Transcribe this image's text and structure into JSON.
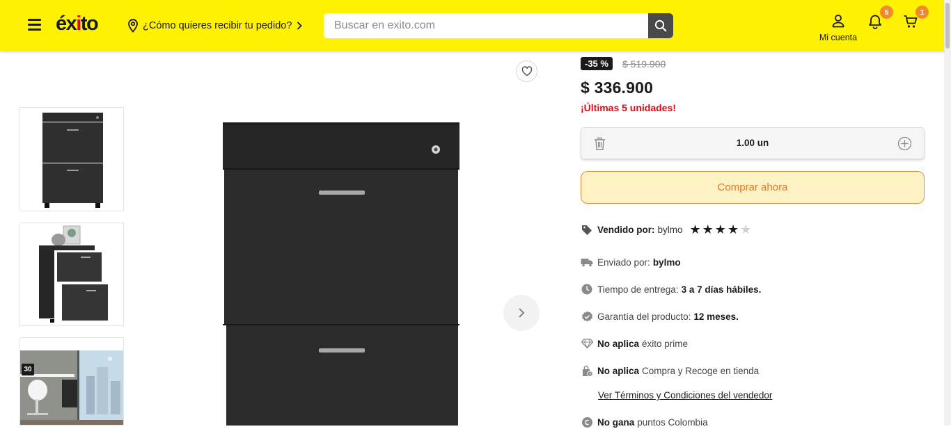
{
  "header": {
    "logo_text": "éxito",
    "location_prompt": "¿Cómo quieres recibir tu pedido?",
    "search_placeholder": "Buscar en exito.com",
    "account_label": "Mi cuenta",
    "notifications_count": "5",
    "cart_count": "1",
    "bg_color": "#fff200",
    "badge_color": "#f08a2c"
  },
  "gallery": {
    "thumbnails": [
      {
        "alt": "Archivador cerrado"
      },
      {
        "alt": "Archivador con cajones abiertos"
      },
      {
        "alt": "Archivador en oficina",
        "badge": "30"
      }
    ]
  },
  "product": {
    "discount": "-35 %",
    "old_price": "$ 519.900",
    "price": "$ 336.900",
    "stock_message": "¡Últimas 5 unidades!",
    "quantity": "1.00 un",
    "buy_label": "Comprar ahora",
    "seller_label": "Vendido por:",
    "seller_name": "bylmo",
    "seller_rating": 4,
    "seller_rating_max": 5,
    "shipped_label": "Enviado por:",
    "shipped_by": "bylmo",
    "delivery_label": "Tiempo de entrega:",
    "delivery_value": "3 a 7 días hábiles.",
    "warranty_label": "Garantía del producto:",
    "warranty_value": "12 meses.",
    "prime_status": "No aplica",
    "prime_label": "éxito prime",
    "pickup_status": "No aplica",
    "pickup_label": "Compra y Recoge en tienda",
    "terms_link": "Ver Términos y Condiciones del vendedor",
    "points_status": "No gana",
    "points_label": "puntos Colombia",
    "price_alert_color": "#e30613",
    "buy_accent": "#ee8a30"
  }
}
